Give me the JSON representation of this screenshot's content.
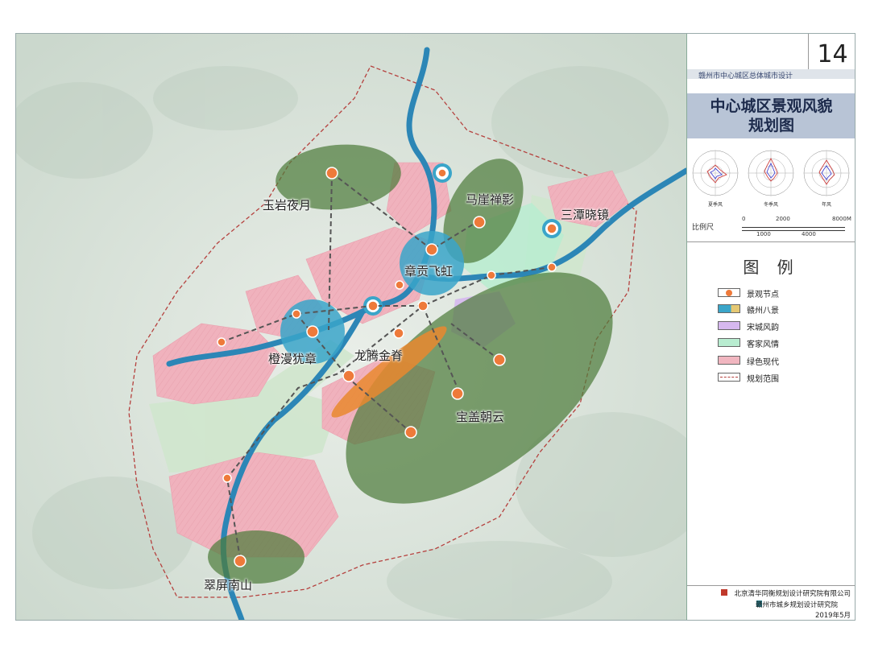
{
  "page_number": "14",
  "project_subtitle": "赣州市中心城区总体城市设计",
  "title": "中心城区景观风貌\n规划图",
  "rose_labels": [
    "夏季风",
    "冬季风",
    "年风"
  ],
  "scale": {
    "label": "比例尺",
    "ticks_top": [
      "0",
      "2000",
      "8000M"
    ],
    "ticks_bottom": [
      "1000",
      "4000"
    ]
  },
  "legend": {
    "title": "图 例",
    "items": [
      {
        "label": "景观节点",
        "color": "#ee7a3a"
      },
      {
        "label": "赣州八景",
        "color": "#3aa5c9"
      },
      {
        "label": "宋城风韵",
        "color": "#d6b8ef"
      },
      {
        "label": "客家风情",
        "color": "#b8ecd0"
      },
      {
        "label": "绿色现代",
        "color": "#f1b6c0"
      },
      {
        "label": "规划范围",
        "color": "#b5413e"
      }
    ]
  },
  "footer": {
    "org1": "北京清华同衡规划设计研究院有限公司",
    "org2": "赣州市城乡规划设计研究院",
    "date": "2019年5月"
  },
  "map_labels": {
    "yuyan": "玉岩夜月",
    "maya": "马崖禅影",
    "santan": "三潭晓镜",
    "zhanggong": "章贡飞虹",
    "chengman": "橙漫犹章",
    "longteng": "龙腾金脊",
    "baogai": "宝盖朝云",
    "cuiping": "翠屏南山"
  },
  "colors": {
    "terrain": "#dfe7e0",
    "river": "#2c86b6",
    "green_zone": "#4f7d3c",
    "pink_urban": "#f1b6c0",
    "purple_song": "#d6b8ef",
    "mint_hakka": "#b8ecd0",
    "node": "#ee7a3a",
    "eight_view": "#3aa5c9",
    "boundary": "#b5413e"
  }
}
